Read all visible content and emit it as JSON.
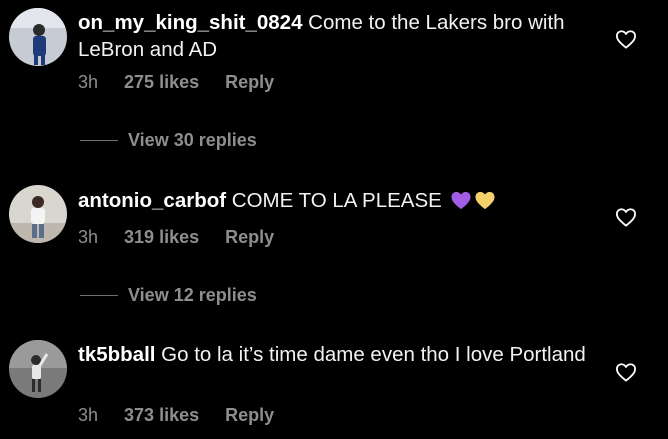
{
  "comments": [
    {
      "username": "on_my_king_shit_0824",
      "text": " Come to the Lakers bro with LeBron and AD",
      "time": "3h",
      "likes": "275 likes",
      "reply_label": "Reply",
      "view_replies_label": "View 30 replies",
      "avatar_colors": {
        "bg": "#c7cbd3",
        "figure": "#1e3a78"
      }
    },
    {
      "username": "antonio_carbof",
      "text": " COME TO LA PLEASE ",
      "emoji": [
        "purple-heart",
        "yellow-heart"
      ],
      "time": "3h",
      "likes": "319 likes",
      "reply_label": "Reply",
      "view_replies_label": "View 12 replies",
      "avatar_colors": {
        "bg": "#d9d5cf",
        "figure": "#f4f4f4"
      }
    },
    {
      "username": "tk5bball",
      "text": " Go to la it’s time dame even tho I love Portland",
      "time": "3h",
      "likes": "373 likes",
      "reply_label": "Reply",
      "avatar_colors": {
        "bg": "#7a7a7a",
        "figure": "#e8e8e8"
      }
    }
  ],
  "colors": {
    "background": "#000000",
    "meta_text": "#8e8e8e",
    "emoji_purple": "#a35ce6",
    "emoji_yellow": "#f2d16b"
  }
}
